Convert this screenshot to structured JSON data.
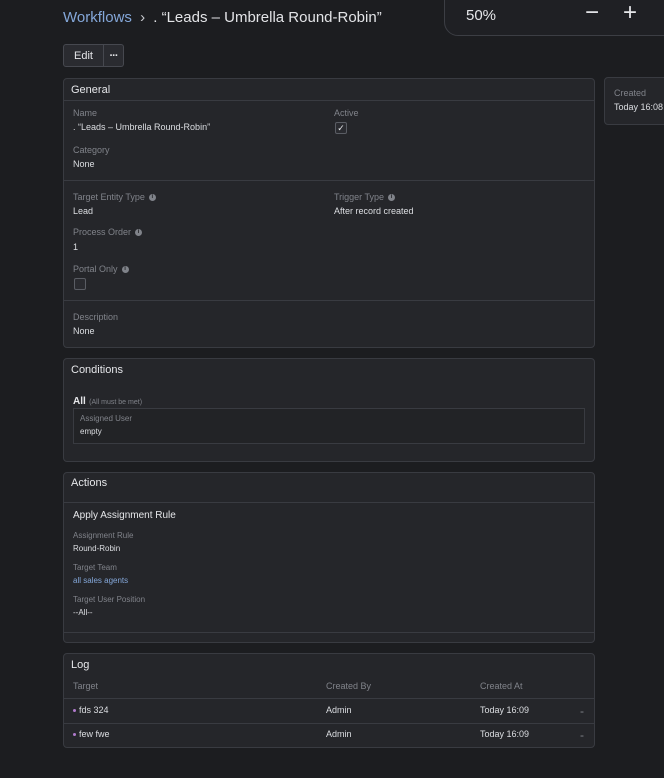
{
  "zoom": {
    "percent": "50%",
    "minus": "−",
    "plus": "+"
  },
  "header": {
    "breadcrumb_link": "Workflows",
    "separator": "›",
    "title": ". “Leads – Umbrella Round-Robin”"
  },
  "buttons": {
    "edit": "Edit",
    "more": "···"
  },
  "general": {
    "title": "General",
    "name_label": "Name",
    "name_value": ". “Leads – Umbrella Round-Robin”",
    "active_label": "Active",
    "active_checked": true,
    "category_label": "Category",
    "category_value": "None",
    "target_entity_label": "Target Entity Type",
    "target_entity_value": "Lead",
    "trigger_type_label": "Trigger Type",
    "trigger_type_value": "After record created",
    "process_order_label": "Process Order",
    "process_order_value": "1",
    "portal_only_label": "Portal Only",
    "description_label": "Description",
    "description_value": "None",
    "info_glyph": "i",
    "check_glyph": "✓"
  },
  "conditions": {
    "title": "Conditions",
    "group_label": "All",
    "group_hint": "(All must be met)",
    "field_label": "Assigned User",
    "field_value": "empty"
  },
  "actions": {
    "title": "Actions",
    "action_title": "Apply Assignment Rule",
    "rule_label": "Assignment Rule",
    "rule_value": "Round-Robin",
    "team_label": "Target Team",
    "team_value": "all sales agents",
    "position_label": "Target User Position",
    "position_value": "--All--"
  },
  "log": {
    "title": "Log",
    "columns": [
      "Target",
      "Created By",
      "Created At"
    ],
    "rows": [
      {
        "target": "fds 324",
        "created_by": "Admin",
        "created_at": "Today 16:09",
        "menu": "-"
      },
      {
        "target": "few fwe",
        "created_by": "Admin",
        "created_at": "Today 16:09",
        "menu": "-"
      }
    ]
  },
  "side": {
    "created_label": "Created",
    "created_value": "Today 16:08"
  }
}
